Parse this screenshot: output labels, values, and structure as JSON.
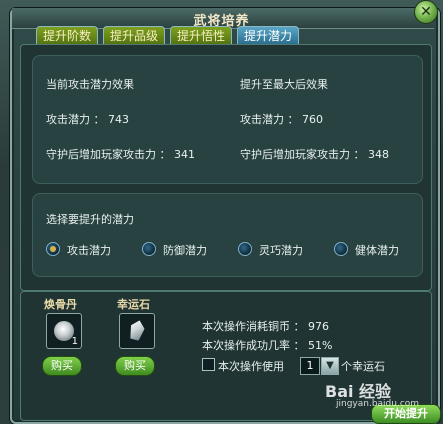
{
  "window": {
    "title": "武将培养",
    "close_label": "✕"
  },
  "tabs": [
    {
      "label": "提升阶数",
      "active": false
    },
    {
      "label": "提升品级",
      "active": false
    },
    {
      "label": "提升悟性",
      "active": false
    },
    {
      "label": "提升潜力",
      "active": true
    }
  ],
  "current_effect": {
    "heading": "当前攻击潜力效果",
    "attack_potential": "攻击潜力 ： 743",
    "guard_bonus": "守护后增加玩家攻击力 ： 341"
  },
  "max_effect": {
    "heading": "提升至最大后效果",
    "attack_potential": "攻击潜力 ： 760",
    "guard_bonus": "守护后增加玩家攻击力 ： 348"
  },
  "potential_select": {
    "heading": "选择要提升的潜力",
    "options": [
      {
        "label": "攻击潜力",
        "checked": true
      },
      {
        "label": "防御潜力",
        "checked": false
      },
      {
        "label": "灵巧潜力",
        "checked": false
      },
      {
        "label": "健体潜力",
        "checked": false
      }
    ]
  },
  "items": [
    {
      "name": "焕骨丹",
      "icon": "orb-icon",
      "count": "1",
      "buy_label": "购买"
    },
    {
      "name": "幸运石",
      "icon": "gem-icon",
      "count": "",
      "buy_label": "购买"
    }
  ],
  "operation": {
    "cost_text": "本次操作消耗铜币 ： 976",
    "success_text": "本次操作成功几率 ： 51%",
    "use_label": "本次操作使用",
    "stone_quantity": "1",
    "unit_label": "个幸运石"
  },
  "primary_button": "开始提升",
  "watermark": {
    "brand": "Bai 经验",
    "url": "jingyan.baidu.com"
  },
  "colors": {
    "tab_active": "#2b6f8e",
    "tab_inactive": "#557311",
    "button_green": "#3d8d25"
  }
}
